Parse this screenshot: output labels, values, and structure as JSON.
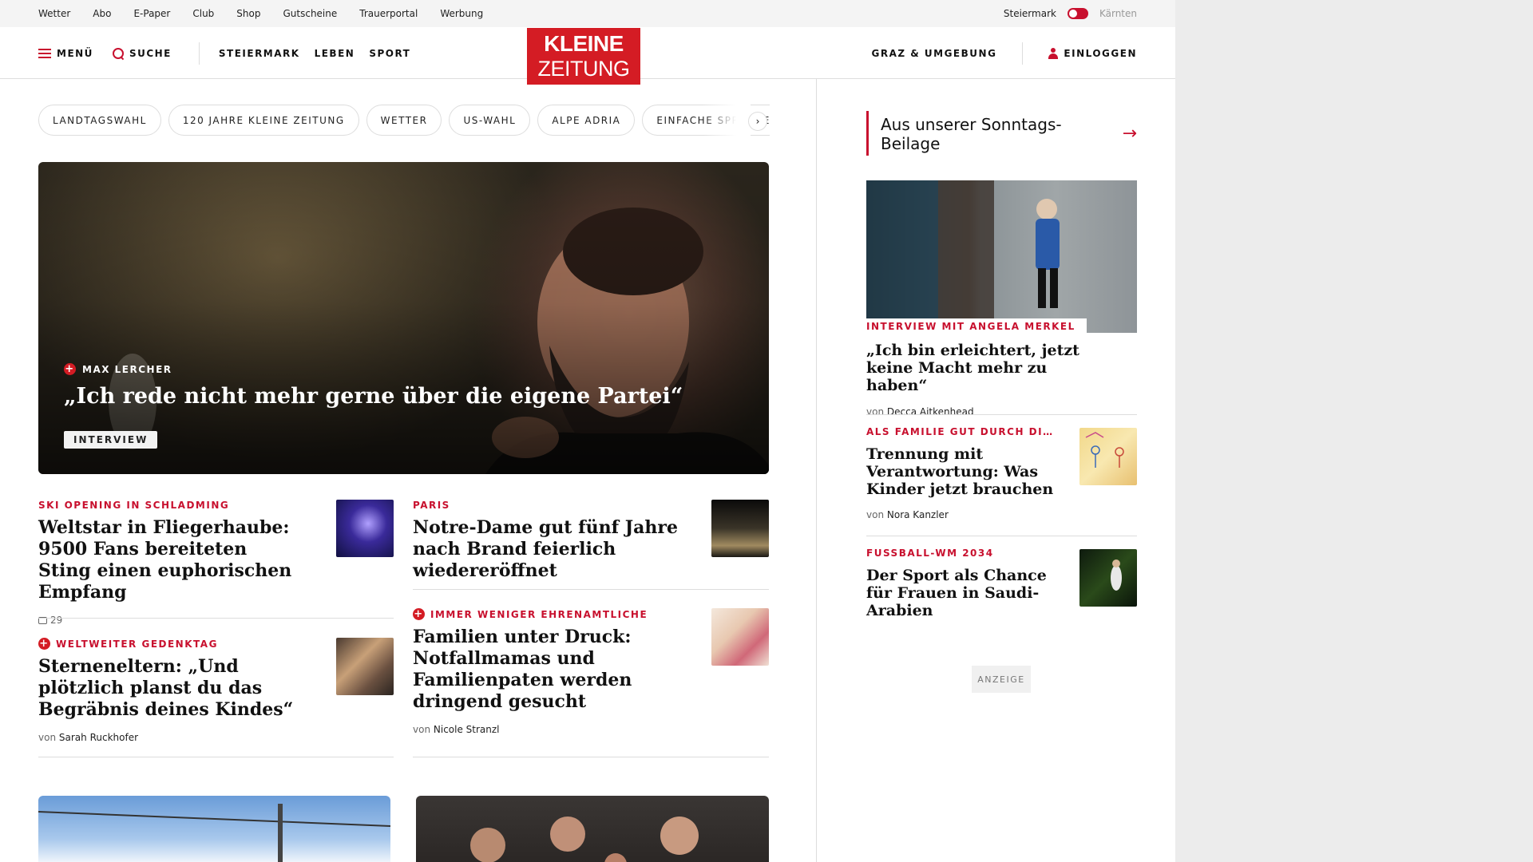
{
  "topbar": {
    "links": [
      "Wetter",
      "Abo",
      "E-Paper",
      "Club",
      "Shop",
      "Gutscheine",
      "Trauerportal",
      "Werbung"
    ],
    "region_current": "Steiermark",
    "region_other": "Kärnten"
  },
  "header": {
    "menu_label": "MENÜ",
    "search_label": "SUCHE",
    "sections": [
      "STEIERMARK",
      "LEBEN",
      "SPORT"
    ],
    "logo_line1": "KLEINE",
    "logo_line2": "ZEITUNG",
    "region_link": "GRAZ & UMGEBUNG",
    "login_label": "EINLOGGEN"
  },
  "topics": [
    "LANDTAGSWAHL",
    "120 JAHRE KLEINE ZEITUNG",
    "WETTER",
    "US-WAHL",
    "ALPE ADRIA",
    "EINFACHE SPRACHE"
  ],
  "topics_next_icon": "chevron-right-icon",
  "hero": {
    "kicker": "MAX LERCHER",
    "premium_icon": "plus-icon",
    "title": "„Ich rede nicht mehr gerne über die eigene Partei“",
    "badge": "INTERVIEW"
  },
  "articles": [
    {
      "kicker": "SKI OPENING IN SCHLADMING",
      "title": "Weltstar in Fliegerhaube: 9500 Fans bereiteten Sting einen euphorischen Empfang",
      "comments": "29"
    },
    {
      "kicker": "PARIS",
      "title": "Notre-Dame gut fünf Jahre nach Brand feierlich wiedereröffnet"
    },
    {
      "kicker": "WELTWEITER GEDENKTAG",
      "premium": true,
      "title": "Sterneneltern: „Und plötzlich planst du das Begräbnis deines Kindes“",
      "byline_prefix": "von",
      "author": "Sarah Ruckhofer"
    },
    {
      "kicker": "IMMER WENIGER EHRENAMTLICHE",
      "premium": true,
      "title": "Familien unter Druck: Notfallmamas und Familienpaten werden dringend gesucht",
      "byline_prefix": "von",
      "author": "Nicole Stranzl"
    }
  ],
  "sidebar": {
    "heading": "Aus unserer Sonntags-Beilage",
    "arrow_icon": "arrow-right-icon",
    "items": [
      {
        "kicker": "INTERVIEW MIT ANGELA MERKEL",
        "title": "„Ich bin erleichtert, jetzt keine Macht mehr zu haben“",
        "byline_prefix": "von",
        "author": "Decca Aitkenhead"
      },
      {
        "kicker": "ALS FAMILIE GUT DURCH DI…",
        "title": "Trennung mit Verantwortung: Was Kinder jetzt brauchen",
        "byline_prefix": "von",
        "author": "Nora Kanzler"
      },
      {
        "kicker": "FUSSBALL-WM 2034",
        "title": "Der Sport als Chance für Frauen in Saudi-Arabien"
      }
    ],
    "ad_label": "ANZEIGE"
  },
  "colors": {
    "brand_red": "#d41c24",
    "kicker_red": "#c8102e",
    "divider": "#dddddd",
    "topbar_bg": "#f4f4f4"
  }
}
